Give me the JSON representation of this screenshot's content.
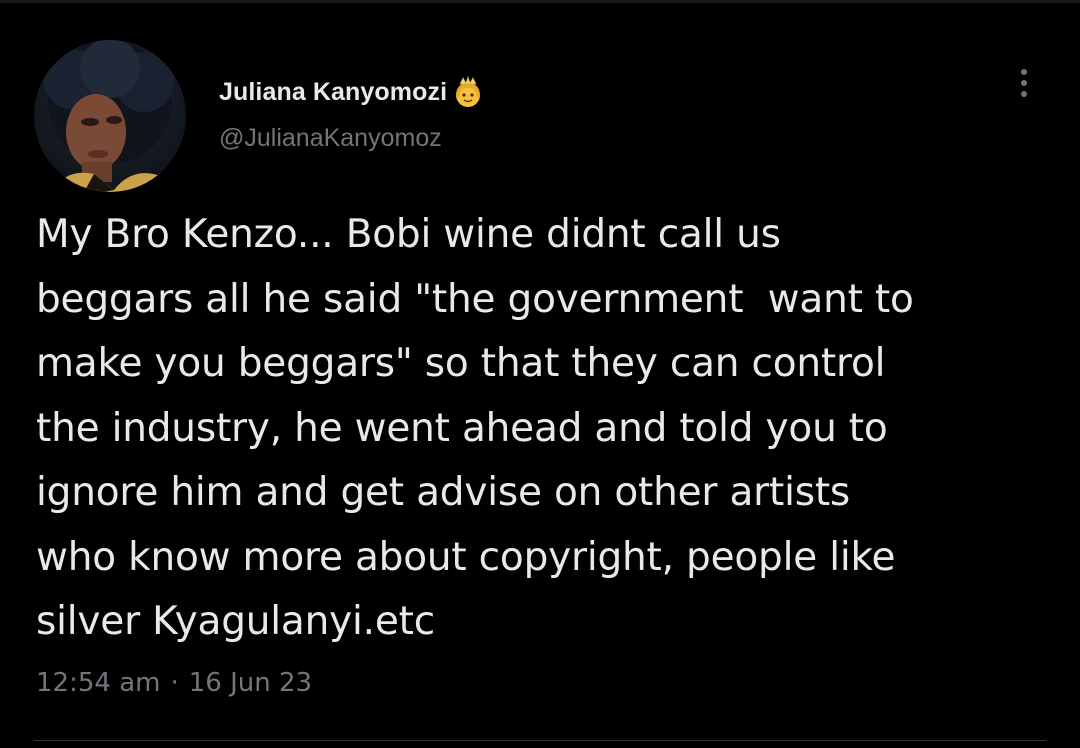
{
  "author": {
    "display_name": "Juliana Kanyomozi",
    "handle": "@JulianaKanyomoz",
    "badge_icon": "princess-emoji-icon"
  },
  "tweet": {
    "text": "My Bro Kenzo... Bobi wine didnt call us\nbeggars all he said \"the government  want to\nmake you beggars\" so that they can control\nthe industry, he went ahead and told you to\nignore him and get advise on other artists\nwho know more about copyright, people like\nsilver Kyagulanyi.etc",
    "time": "12:54 am",
    "separator": "·",
    "date": "16 Jun 23"
  },
  "icons": {
    "more": "more-vertical-icon",
    "avatar": "avatar"
  },
  "colors": {
    "background": "#000000",
    "primary_text": "#e7e9ea",
    "secondary_text": "#71767b",
    "divider": "#2f3336"
  }
}
